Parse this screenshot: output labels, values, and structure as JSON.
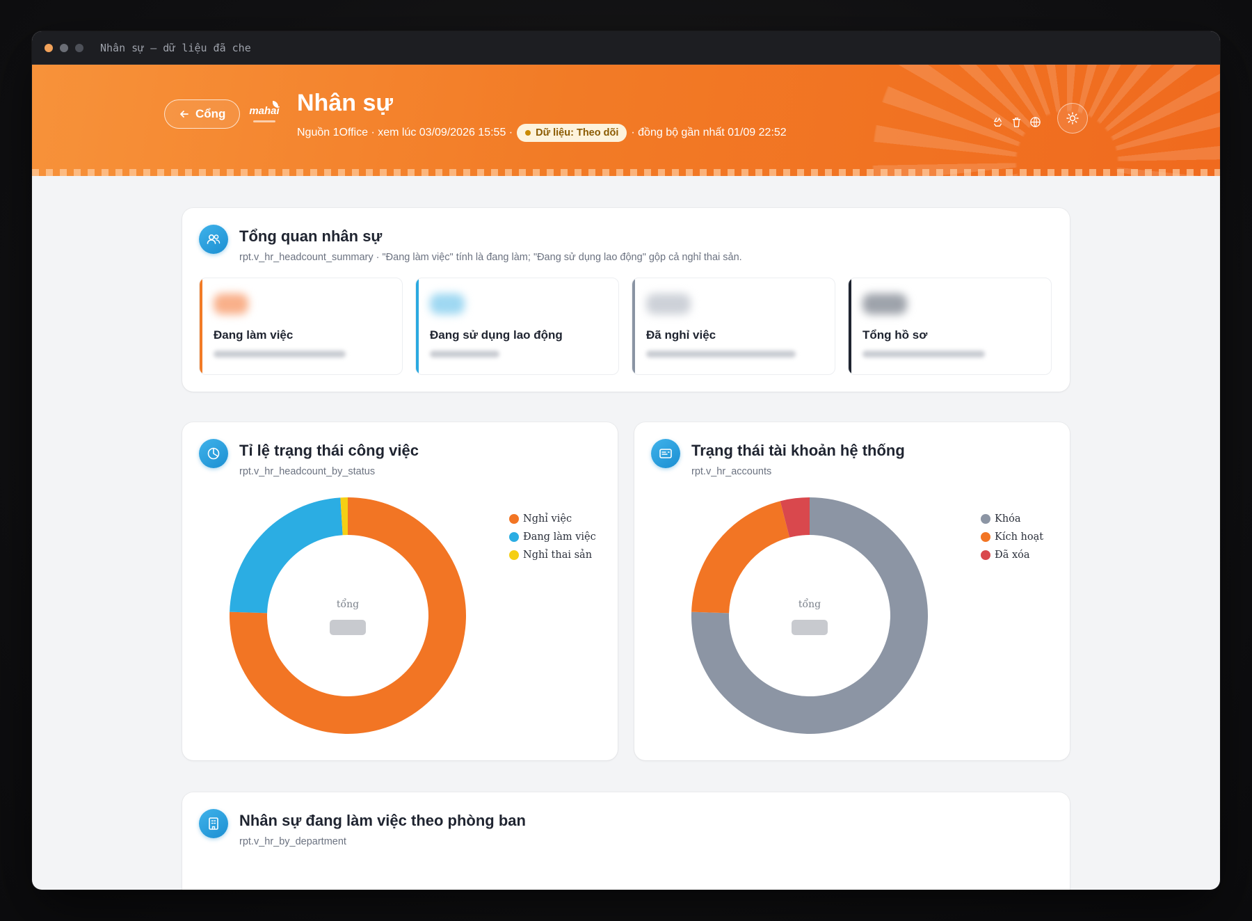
{
  "window": {
    "title": "Nhân sự — dữ liệu đã che"
  },
  "header": {
    "back_label": "Cổng",
    "logo_text": "mahai",
    "title": "Nhân sự",
    "meta_source": "Nguồn 1Office · xem lúc 03/09/2026 15:55 ·",
    "data_pill": "Dữ liệu: Theo dõi",
    "meta_sync": "· đồng bộ gần nhất 01/09 22:52",
    "icons": [
      "recycle-icon",
      "trash-icon",
      "globe-icon"
    ],
    "theme_icon": "sun-icon"
  },
  "overview": {
    "title": "Tổng quan nhân sự",
    "subtitle": "rpt.v_hr_headcount_summary · \"Đang làm việc\" tính là đang làm; \"Đang sử dụng lao động\" gộp cả nghỉ thai sản.",
    "icon": "users-icon",
    "stats": [
      {
        "label": "Đang làm việc",
        "accent": "#f27b26"
      },
      {
        "label": "Đang sử dụng lao động",
        "accent": "#2aa9e0"
      },
      {
        "label": "Đã nghỉ việc",
        "accent": "#8a94a3"
      },
      {
        "label": "Tổng hồ sơ",
        "accent": "#1f2430"
      }
    ]
  },
  "status_ratio": {
    "title": "Tỉ lệ trạng thái công việc",
    "subtitle": "rpt.v_hr_headcount_by_status",
    "icon": "pie-icon",
    "center_label": "tổng",
    "legend": [
      {
        "label": "Nghỉ việc",
        "color": "#f27524"
      },
      {
        "label": "Đang làm việc",
        "color": "#2badE3"
      },
      {
        "label": "Nghỉ thai sản",
        "color": "#f5cf14"
      }
    ]
  },
  "account_status": {
    "title": "Trạng thái tài khoản hệ thống",
    "subtitle": "rpt.v_hr_accounts",
    "icon": "id-card-icon",
    "center_label": "tổng",
    "legend": [
      {
        "label": "Khóa",
        "color": "#8c95a4"
      },
      {
        "label": "Kích hoạt",
        "color": "#f27524"
      },
      {
        "label": "Đã xóa",
        "color": "#d9484d"
      }
    ]
  },
  "by_department": {
    "title": "Nhân sự đang làm việc theo phòng ban",
    "subtitle": "rpt.v_hr_by_department",
    "icon": "building-icon"
  },
  "chart_data": [
    {
      "type": "pie",
      "categories": [
        "Nghỉ việc",
        "Đang làm việc",
        "Nghỉ thai sản"
      ],
      "values": [
        75.5,
        23.5,
        1.0
      ]
    },
    {
      "type": "pie",
      "categories": [
        "Khóa",
        "Kích hoạt",
        "Đã xóa"
      ],
      "values": [
        75.5,
        20.5,
        4.0
      ]
    }
  ]
}
